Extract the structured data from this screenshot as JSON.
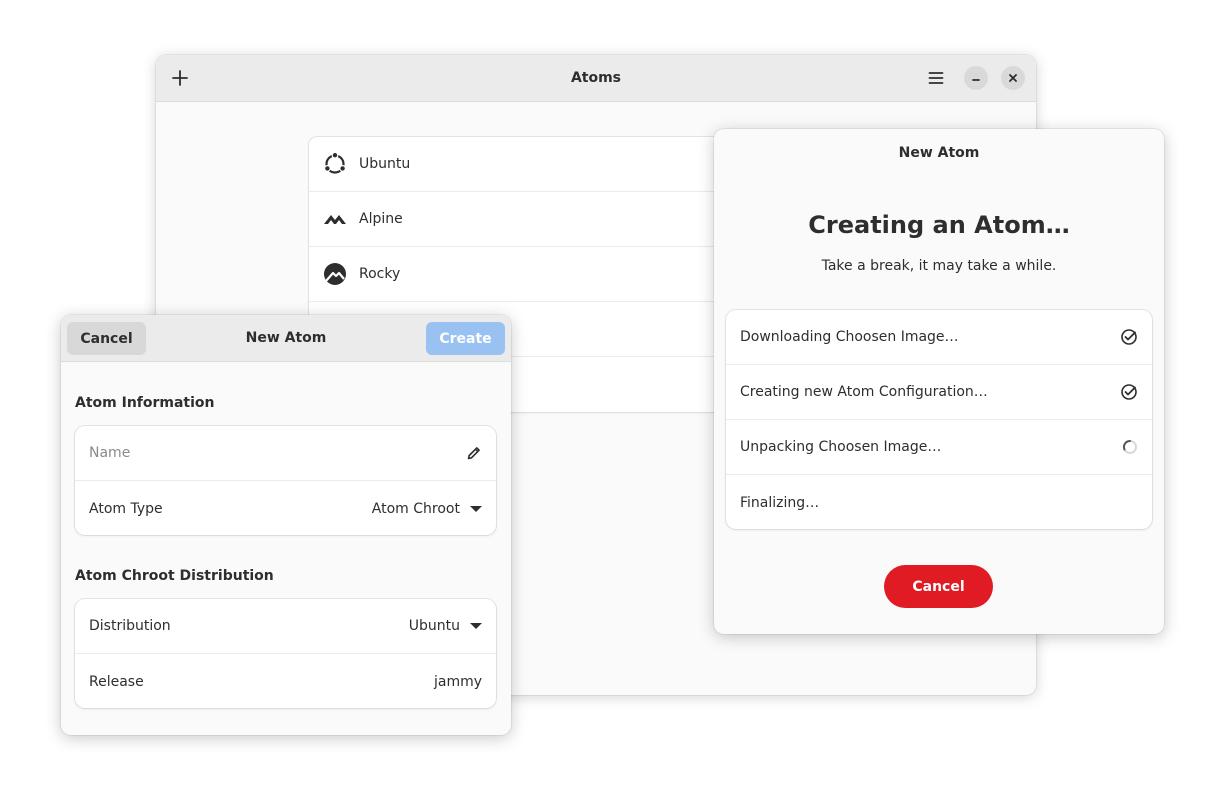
{
  "main_window": {
    "title": "Atoms",
    "add_icon": "plus-icon",
    "menu_icon": "hamburger-menu-icon",
    "minimize_icon": "minimize-icon",
    "close_icon": "close-icon",
    "atoms": [
      {
        "label": "Ubuntu",
        "icon": "ubuntu-logo-icon"
      },
      {
        "label": "Alpine",
        "icon": "alpine-logo-icon"
      },
      {
        "label": "Rocky",
        "icon": "rocky-logo-icon"
      },
      {
        "label": "",
        "icon": ""
      },
      {
        "label": "",
        "icon": ""
      }
    ]
  },
  "new_atom_form": {
    "title": "New Atom",
    "cancel_label": "Cancel",
    "create_label": "Create",
    "atom_information": {
      "title": "Atom Information",
      "name_placeholder": "Name",
      "name_icon": "pencil-icon",
      "atom_type_label": "Atom Type",
      "atom_type_value": "Atom Chroot"
    },
    "distribution_section": {
      "title": "Atom Chroot Distribution",
      "distribution_label": "Distribution",
      "distribution_value": "Ubuntu",
      "release_label": "Release",
      "release_value": "jammy"
    }
  },
  "creating_dialog": {
    "title": "New Atom",
    "heading": "Creating an Atom…",
    "subtitle": "Take a break, it may take a while.",
    "steps": [
      {
        "label": "Downloading Choosen Image…",
        "status": "done"
      },
      {
        "label": "Creating new Atom Configuration…",
        "status": "done"
      },
      {
        "label": "Unpacking Choosen Image…",
        "status": "in-progress"
      },
      {
        "label": "Finalizing…",
        "status": "pending"
      }
    ],
    "cancel_label": "Cancel"
  },
  "colors": {
    "accent_blue_disabled": "#99c1f1",
    "destructive_red": "#e01b24",
    "header_bg": "#ebebeb",
    "window_bg": "#fafafa"
  }
}
